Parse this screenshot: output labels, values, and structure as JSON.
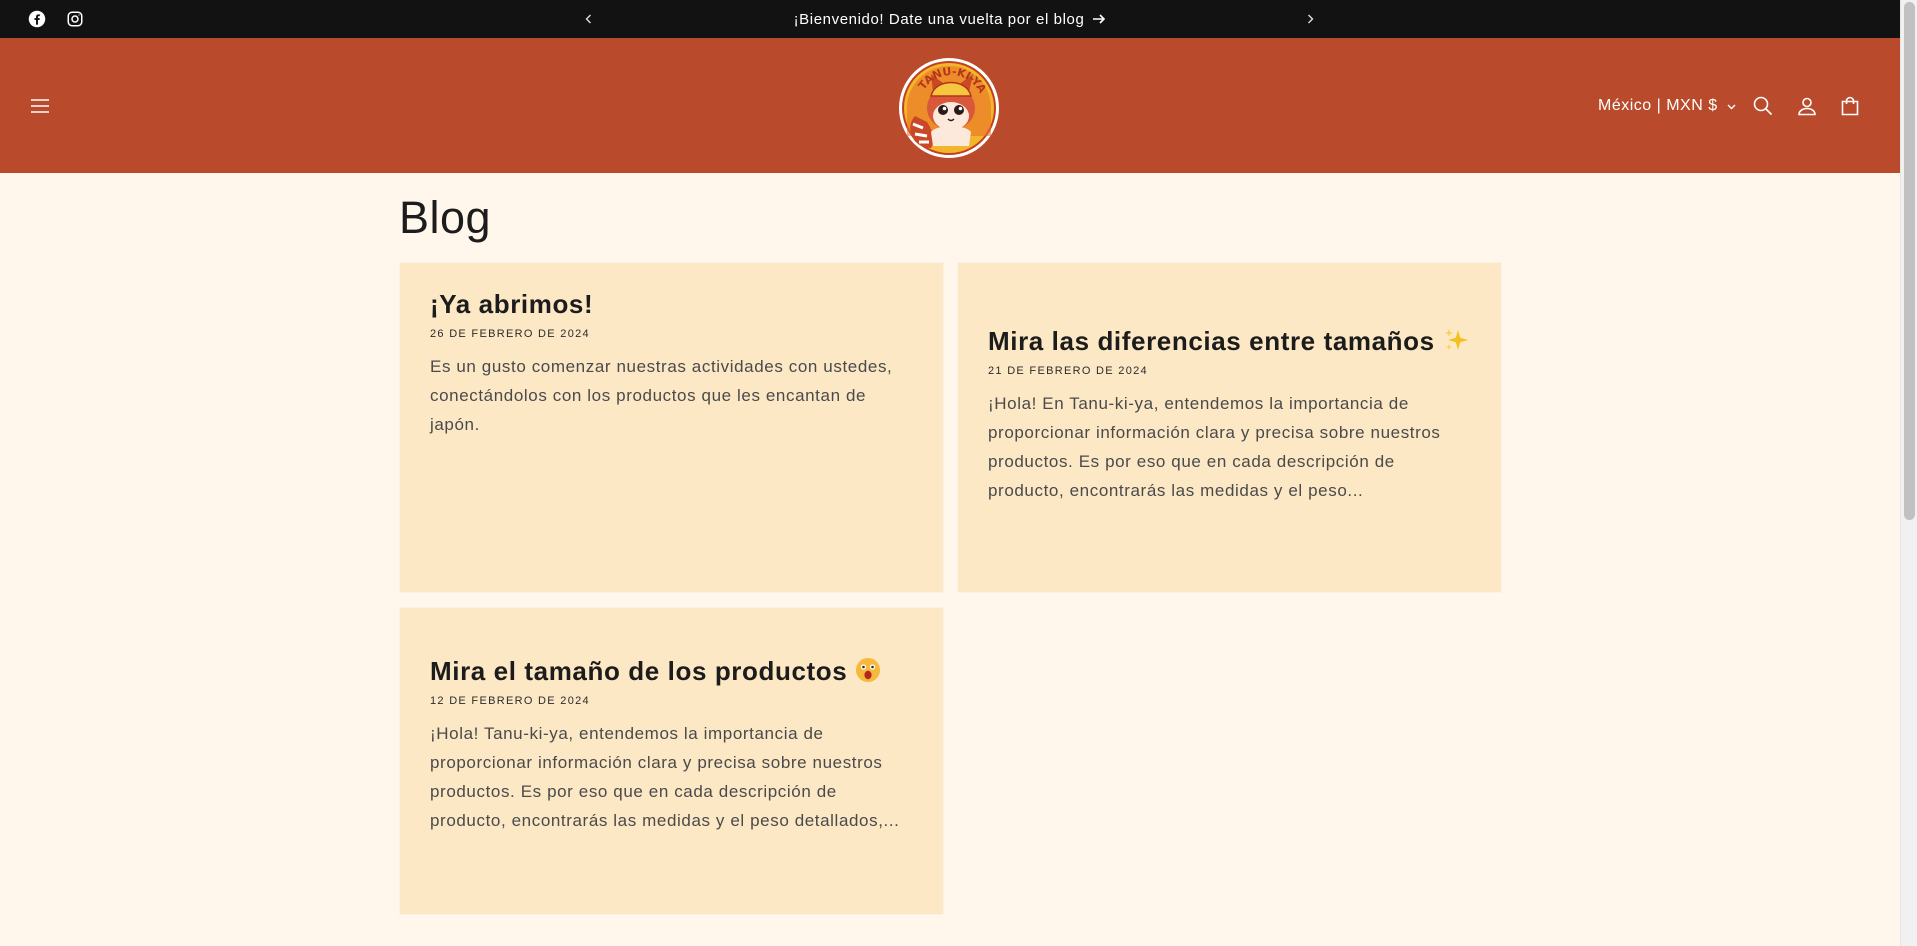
{
  "announcement": {
    "text": "¡Bienvenido! Date una vuelta por el blog",
    "social": [
      "facebook-icon",
      "instagram-icon"
    ]
  },
  "header": {
    "logo_text": "TANU-KI-YA",
    "locale": "México | MXN $"
  },
  "page": {
    "title": "Blog"
  },
  "articles": [
    {
      "title": "¡Ya abrimos!",
      "date": "26 DE FEBRERO DE 2024",
      "excerpt": "Es un gusto comenzar nuestras actividades con ustedes, conectándolos con los productos que les encantan de japón."
    },
    {
      "title": "Mira las diferencias entre tamaños",
      "emoji": "sparkles-icon",
      "date": "21 DE FEBRERO DE 2024",
      "excerpt": "¡Hola! En Tanu-ki-ya, entendemos la importancia de proporcionar información clara y precisa sobre nuestros productos. Es por eso que en cada descripción de producto, encontrarás las medidas y el peso..."
    },
    {
      "title": "Mira el tamaño de los productos",
      "emoji": "astonished-face-icon",
      "date": "12 DE FEBRERO DE 2024",
      "excerpt": "¡Hola! Tanu-ki-ya, entendemos la importancia de proporcionar información clara y precisa sobre nuestros productos. Es por eso que en cada descripción de producto, encontrarás las medidas y el peso detallados,..."
    }
  ],
  "colors": {
    "announcement_bg": "#121212",
    "header_bg": "#b94b2c",
    "page_bg": "#fff7ec",
    "card_bg": "#fde8c6"
  }
}
